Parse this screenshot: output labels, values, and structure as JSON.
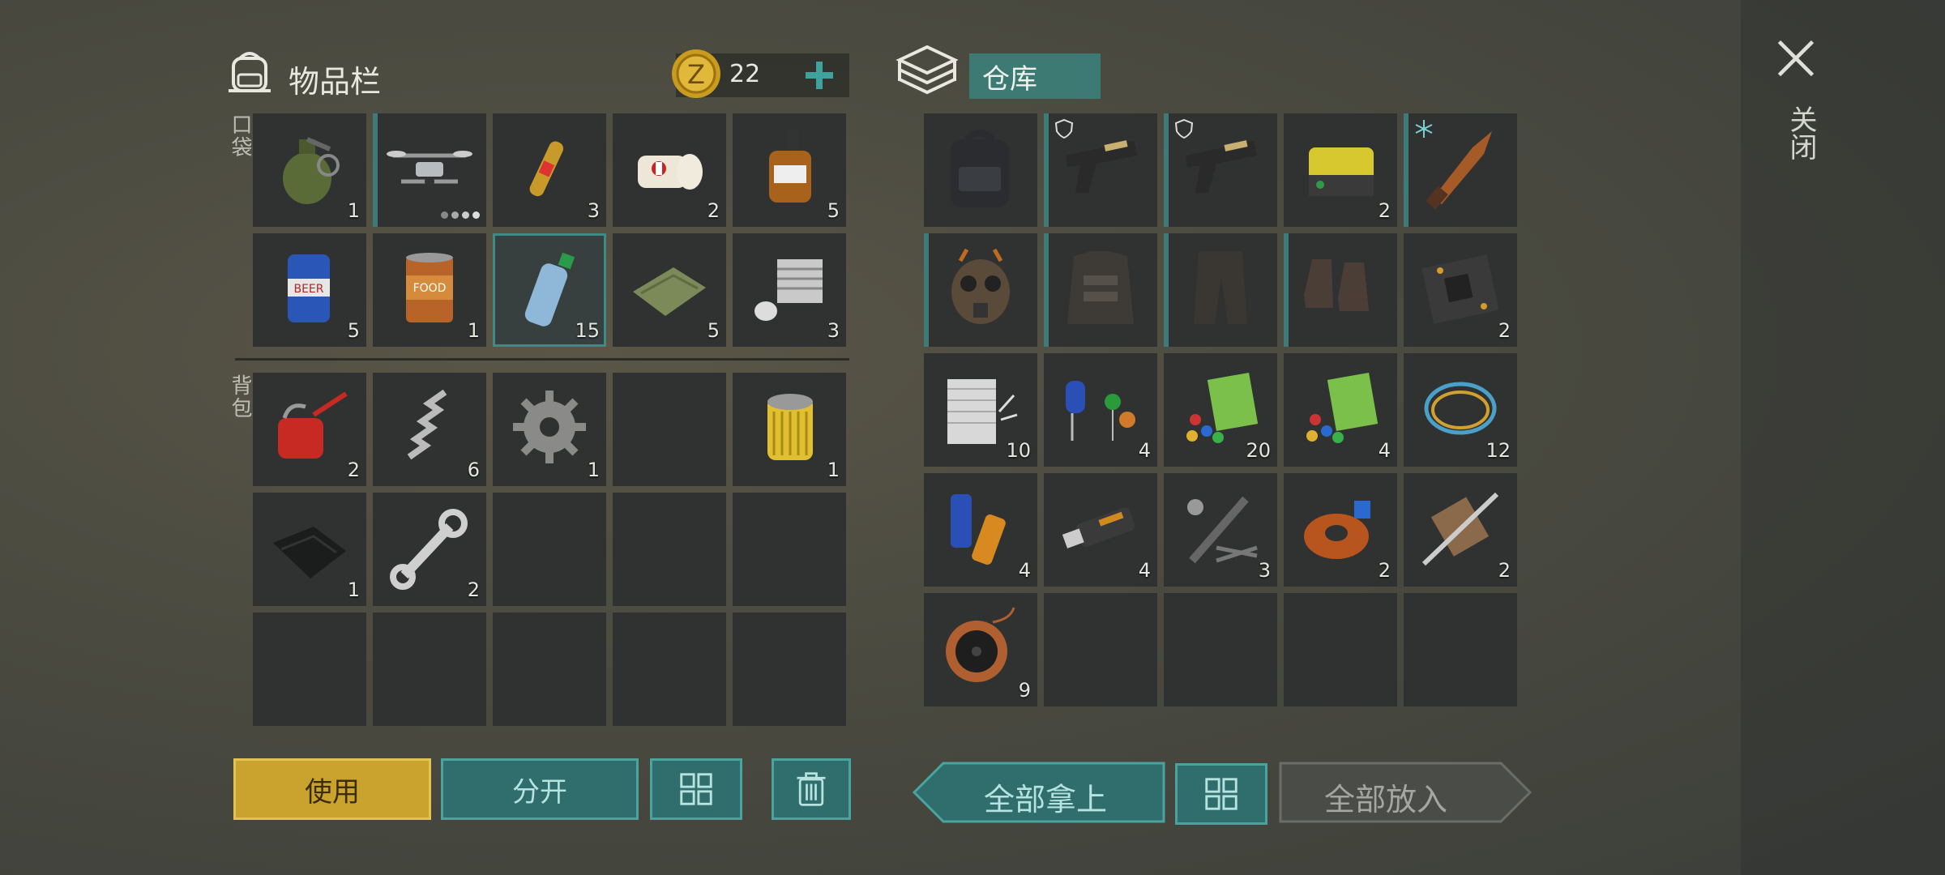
{
  "inventory": {
    "title": "物品栏",
    "coins": "22",
    "pockets_label": "口袋",
    "backpack_label": "背包",
    "pockets": [
      {
        "name": "grenade-icon",
        "count": "1"
      },
      {
        "name": "drone-icon",
        "count": ""
      },
      {
        "name": "ampoule-icon",
        "count": "3"
      },
      {
        "name": "bandage-icon",
        "count": "2"
      },
      {
        "name": "whiskey-bottle-icon",
        "count": "5"
      },
      {
        "name": "beer-can-icon",
        "count": "5"
      },
      {
        "name": "food-can-icon",
        "count": "1"
      },
      {
        "name": "water-bottle-icon",
        "count": "15"
      },
      {
        "name": "cloth-icon",
        "count": "5"
      },
      {
        "name": "engine-cylinder-icon",
        "count": "3"
      }
    ],
    "backpack": [
      {
        "name": "oil-can-icon",
        "count": "2"
      },
      {
        "name": "spring-icon",
        "count": "6"
      },
      {
        "name": "gear-icon",
        "count": "1"
      },
      {
        "name": "",
        "count": ""
      },
      {
        "name": "oil-filter-icon",
        "count": "1"
      },
      {
        "name": "leather-icon",
        "count": "1"
      },
      {
        "name": "wrench-icon",
        "count": "2"
      },
      {
        "name": "",
        "count": ""
      },
      {
        "name": "",
        "count": ""
      },
      {
        "name": "",
        "count": ""
      },
      {
        "name": "",
        "count": ""
      },
      {
        "name": "",
        "count": ""
      },
      {
        "name": "",
        "count": ""
      },
      {
        "name": "",
        "count": ""
      },
      {
        "name": "",
        "count": ""
      }
    ]
  },
  "storage": {
    "title": "仓库",
    "items": [
      {
        "name": "backpack-icon",
        "count": ""
      },
      {
        "name": "pistol-icon",
        "count": ""
      },
      {
        "name": "pistol-icon",
        "count": ""
      },
      {
        "name": "battery-pack-icon",
        "count": "2"
      },
      {
        "name": "combat-knife-icon",
        "count": ""
      },
      {
        "name": "gas-mask-icon",
        "count": ""
      },
      {
        "name": "armor-vest-icon",
        "count": ""
      },
      {
        "name": "armor-pants-icon",
        "count": ""
      },
      {
        "name": "armor-boots-icon",
        "count": ""
      },
      {
        "name": "circuit-board-icon",
        "count": "2"
      },
      {
        "name": "fiberglass-icon",
        "count": "10"
      },
      {
        "name": "capacitors-icon",
        "count": "4"
      },
      {
        "name": "electronic-parts-icon",
        "count": "20"
      },
      {
        "name": "electronic-parts-icon",
        "count": "4"
      },
      {
        "name": "wire-icon",
        "count": "12"
      },
      {
        "name": "batteries-icon",
        "count": "4"
      },
      {
        "name": "usb-drive-icon",
        "count": "4"
      },
      {
        "name": "tools-kit-icon",
        "count": "3"
      },
      {
        "name": "coil-icon",
        "count": "2"
      },
      {
        "name": "motor-rotor-icon",
        "count": "2"
      },
      {
        "name": "copper-wire-spool-icon",
        "count": "9"
      },
      {
        "name": "",
        "count": ""
      },
      {
        "name": "",
        "count": ""
      },
      {
        "name": "",
        "count": ""
      },
      {
        "name": "",
        "count": ""
      }
    ]
  },
  "buttons": {
    "use": "使用",
    "split": "分开",
    "take_all": "全部拿上",
    "put_all": "全部放入",
    "close": "关闭"
  },
  "colors": {
    "accent": "#2f6e6c",
    "gold": "#c9a32e",
    "slot": "#2f3230"
  }
}
